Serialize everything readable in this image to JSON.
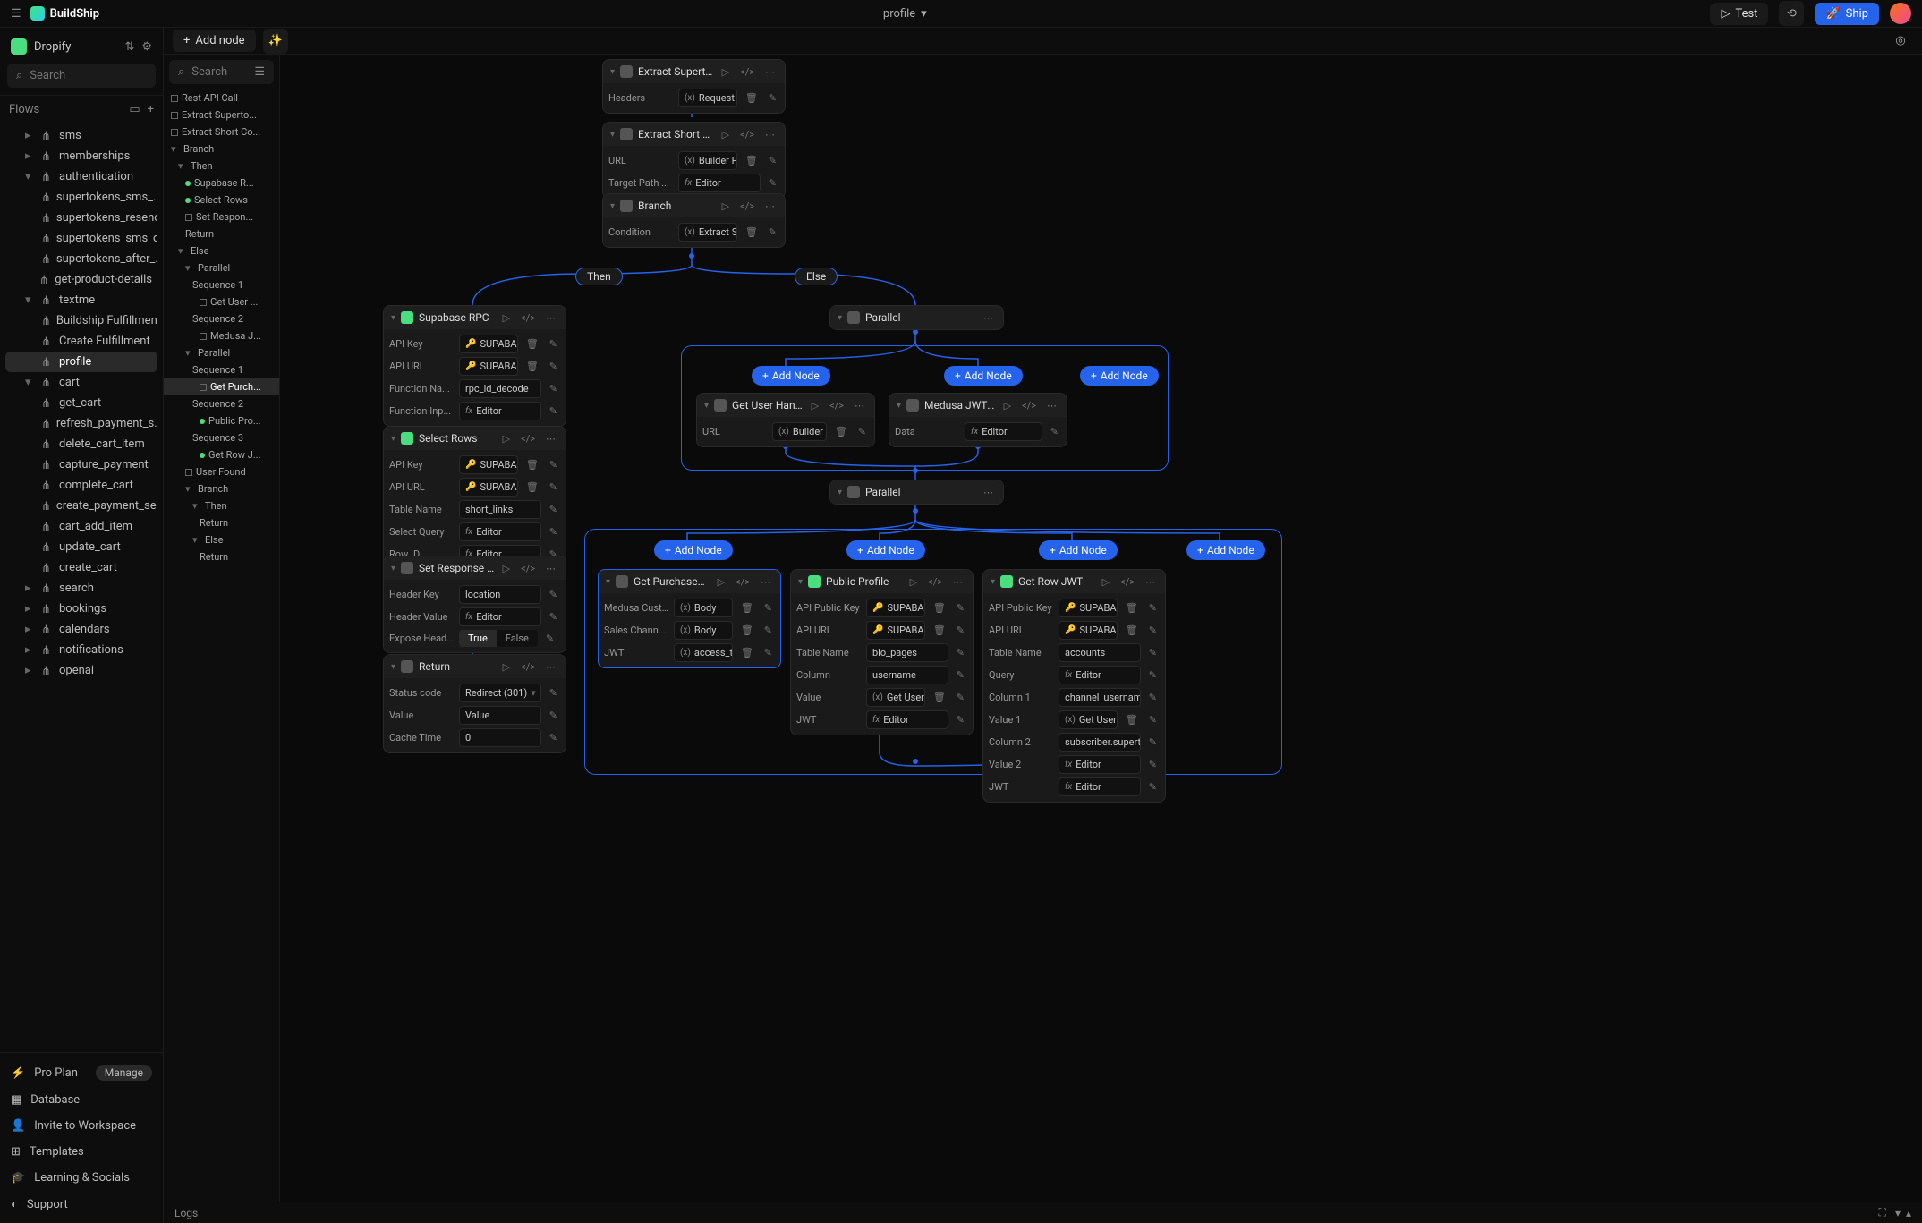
{
  "app": {
    "name": "BuildShip",
    "breadcrumb": "profile"
  },
  "toolbar": {
    "test": "Test",
    "ship": "Ship",
    "add_node": "Add node"
  },
  "project": {
    "name": "Dropify"
  },
  "search": {
    "placeholder": "Search"
  },
  "flows_label": "Flows",
  "tree": [
    {
      "label": "sms",
      "level": 1,
      "chev": "▸"
    },
    {
      "label": "memberships",
      "level": 1,
      "chev": "▸"
    },
    {
      "label": "authentication",
      "level": 1,
      "chev": "▾"
    },
    {
      "label": "supertokens_sms_...",
      "level": 2
    },
    {
      "label": "supertokens_resend",
      "level": 2
    },
    {
      "label": "supertokens_sms_d...",
      "level": 2
    },
    {
      "label": "supertokens_after_...",
      "level": 2
    },
    {
      "label": "get-product-details",
      "level": 1
    },
    {
      "label": "textme",
      "level": 1,
      "chev": "▾"
    },
    {
      "label": "Buildship Fulfillmen...",
      "level": 2
    },
    {
      "label": "Create Fulfillment",
      "level": 2
    },
    {
      "label": "profile",
      "level": 1,
      "selected": true
    },
    {
      "label": "cart",
      "level": 1,
      "chev": "▾"
    },
    {
      "label": "get_cart",
      "level": 2
    },
    {
      "label": "refresh_payment_s...",
      "level": 2
    },
    {
      "label": "delete_cart_item",
      "level": 2
    },
    {
      "label": "capture_payment",
      "level": 2
    },
    {
      "label": "complete_cart",
      "level": 2
    },
    {
      "label": "create_payment_se...",
      "level": 2
    },
    {
      "label": "cart_add_item",
      "level": 2
    },
    {
      "label": "update_cart",
      "level": 2
    },
    {
      "label": "create_cart",
      "level": 2
    },
    {
      "label": "search",
      "level": 1,
      "chev": "▸"
    },
    {
      "label": "bookings",
      "level": 1,
      "chev": "▸"
    },
    {
      "label": "calendars",
      "level": 1,
      "chev": "▸"
    },
    {
      "label": "notifications",
      "level": 1,
      "chev": "▸"
    },
    {
      "label": "openai",
      "level": 1,
      "chev": "▸"
    }
  ],
  "sidebar_bottom": [
    {
      "icon": "⚡",
      "label": "Pro Plan",
      "pill": "Manage"
    },
    {
      "icon": "▦",
      "label": "Database"
    },
    {
      "icon": "👤",
      "label": "Invite to Workspace"
    },
    {
      "icon": "⊞",
      "label": "Templates"
    },
    {
      "icon": "🎓",
      "label": "Learning & Socials"
    },
    {
      "icon": "◐",
      "label": "Support"
    }
  ],
  "outline_search": "Search",
  "outline": [
    {
      "label": "Rest API Call",
      "i": 0,
      "sq": true
    },
    {
      "label": "Extract Superto...",
      "i": 0,
      "sq": true
    },
    {
      "label": "Extract Short Co...",
      "i": 0,
      "sq": true
    },
    {
      "label": "Branch",
      "i": 0,
      "chev": "▾"
    },
    {
      "label": "Then",
      "i": 1,
      "chev": "▾"
    },
    {
      "label": "Supabase R...",
      "i": 2,
      "dot": true
    },
    {
      "label": "Select Rows",
      "i": 2,
      "dot": true
    },
    {
      "label": "Set Respon...",
      "i": 2,
      "sq": true
    },
    {
      "label": "Return",
      "i": 2
    },
    {
      "label": "Else",
      "i": 1,
      "chev": "▾"
    },
    {
      "label": "Parallel",
      "i": 2,
      "chev": "▾"
    },
    {
      "label": "Sequence 1",
      "i": 3
    },
    {
      "label": "Get User ...",
      "i": 4,
      "sq": true
    },
    {
      "label": "Sequence 2",
      "i": 3
    },
    {
      "label": "Medusa J...",
      "i": 4,
      "sq": true
    },
    {
      "label": "Parallel",
      "i": 2,
      "chev": "▾"
    },
    {
      "label": "Sequence 1",
      "i": 3
    },
    {
      "label": "Get Purch...",
      "i": 4,
      "sq": true,
      "sel": true
    },
    {
      "label": "Sequence 2",
      "i": 3
    },
    {
      "label": "Public Pro...",
      "i": 4,
      "dot": true
    },
    {
      "label": "Sequence 3",
      "i": 3
    },
    {
      "label": "Get Row J...",
      "i": 4,
      "dot": true
    },
    {
      "label": "User Found",
      "i": 2,
      "sq": true
    },
    {
      "label": "Branch",
      "i": 2,
      "chev": "▾"
    },
    {
      "label": "Then",
      "i": 3,
      "chev": "▾"
    },
    {
      "label": "Return",
      "i": 4
    },
    {
      "label": "Else",
      "i": 3,
      "chev": "▾"
    },
    {
      "label": "Return",
      "i": 4
    }
  ],
  "branch": {
    "then": "Then",
    "else": "Else"
  },
  "add_node_label": "Add Node",
  "nodes": {
    "extract_supertokens": {
      "title": "Extract Supertoken...",
      "rows": [
        {
          "label": "Headers",
          "val": "Request Head...",
          "var": "(x)"
        }
      ]
    },
    "extract_short": {
      "title": "Extract Short Code",
      "rows": [
        {
          "label": "URL",
          "val": "Builder Page U...",
          "var": "(x)"
        },
        {
          "label": "Target Path ...",
          "val": "Editor",
          "fx": true
        }
      ]
    },
    "branch_node": {
      "title": "Branch",
      "rows": [
        {
          "label": "Condition",
          "val": "Extract Short ...",
          "var": "(x)"
        }
      ]
    },
    "supabase_rpc": {
      "title": "Supabase RPC",
      "green": true,
      "rows": [
        {
          "label": "API Key",
          "val": "SUPABASE_TE...",
          "key": true
        },
        {
          "label": "API URL",
          "val": "SUPABASE_TE...",
          "key": true
        },
        {
          "label": "Function Na...",
          "val": "rpc_id_decode"
        },
        {
          "label": "Function Inp...",
          "val": "Editor",
          "fx": true
        }
      ]
    },
    "select_rows": {
      "title": "Select Rows",
      "green": true,
      "rows": [
        {
          "label": "API Key",
          "val": "SUPABASE_TE...",
          "key": true
        },
        {
          "label": "API URL",
          "val": "SUPABASE_TE...",
          "key": true
        },
        {
          "label": "Table Name",
          "val": "short_links"
        },
        {
          "label": "Select Query",
          "val": "Editor",
          "fx": true
        },
        {
          "label": "Row ID",
          "val": "Editor",
          "fx": true
        }
      ]
    },
    "set_response": {
      "title": "Set Response Hea...",
      "rows": [
        {
          "label": "Header Key",
          "val": "location"
        },
        {
          "label": "Header Value",
          "val": "Editor",
          "fx": true
        },
        {
          "label": "Expose Head...",
          "toggle": [
            "True",
            "False"
          ],
          "on": 0
        }
      ]
    },
    "return_node": {
      "title": "Return",
      "rows": [
        {
          "label": "Status code",
          "val": "Redirect (301)",
          "dd": true
        },
        {
          "label": "Value",
          "val": "Value"
        },
        {
          "label": "Cache Time",
          "val": "0"
        }
      ]
    },
    "parallel1": {
      "title": "Parallel"
    },
    "parallel2": {
      "title": "Parallel"
    },
    "get_user_handle": {
      "title": "Get User Handle",
      "rows": [
        {
          "label": "URL",
          "val": "Builder Page U...",
          "var": "(x)"
        }
      ]
    },
    "medusa_jwt": {
      "title": "Medusa JWT Auth",
      "rows": [
        {
          "label": "Data",
          "val": "Editor",
          "fx": true
        }
      ]
    },
    "get_purchased": {
      "title": "Get Purchased Items",
      "sel": true,
      "rows": [
        {
          "label": "Medusa Cust...",
          "val": "Body",
          "var": "(x)"
        },
        {
          "label": "Sales Chann...",
          "val": "Body",
          "var": "(x)"
        },
        {
          "label": "JWT",
          "val": "access_token",
          "var": "(x)"
        }
      ]
    },
    "public_profile": {
      "title": "Public Profile",
      "green": true,
      "rows": [
        {
          "label": "API Public Key",
          "val": "SUPABASE_T...",
          "key": true
        },
        {
          "label": "API URL",
          "val": "SUPABASE_T...",
          "key": true
        },
        {
          "label": "Table Name",
          "val": "bio_pages"
        },
        {
          "label": "Column",
          "val": "username"
        },
        {
          "label": "Value",
          "val": "Get User Handle",
          "var": "(x)"
        },
        {
          "label": "JWT",
          "val": "Editor",
          "fx": true
        }
      ]
    },
    "get_row_jwt": {
      "title": "Get Row JWT",
      "green": true,
      "rows": [
        {
          "label": "API Public Key",
          "val": "SUPABASE_T...",
          "key": true
        },
        {
          "label": "API URL",
          "val": "SUPABASE_T...",
          "key": true
        },
        {
          "label": "Table Name",
          "val": "accounts"
        },
        {
          "label": "Query",
          "val": "Editor",
          "fx": true
        },
        {
          "label": "Column 1",
          "val": "channel_username"
        },
        {
          "label": "Value 1",
          "val": "Get User Handle",
          "var": "(x)"
        },
        {
          "label": "Column 2",
          "val": "subscriber.supertokens..."
        },
        {
          "label": "Value 2",
          "val": "Editor",
          "fx": true
        },
        {
          "label": "JWT",
          "val": "Editor",
          "fx": true
        }
      ]
    }
  },
  "logs_label": "Logs"
}
